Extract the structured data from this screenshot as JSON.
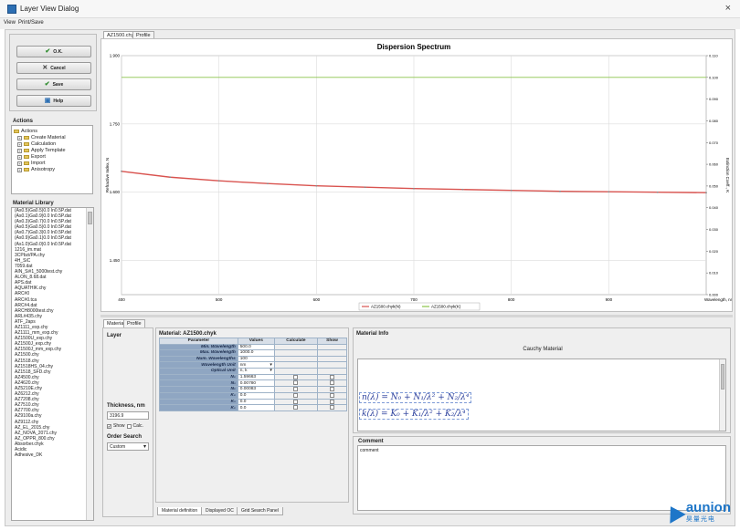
{
  "window": {
    "title": "Layer View Dialog",
    "close_glyph": "×"
  },
  "menu": {
    "items": [
      "View",
      "Print/Save"
    ]
  },
  "buttons": {
    "ok": "O.K.",
    "cancel": "Cancel",
    "save": "Save",
    "help": "Help"
  },
  "actions": {
    "title": "Actions",
    "root": "Actions",
    "items": [
      "Create Material",
      "Calculation",
      "Apply Template",
      "Export",
      "Import",
      "Anisotropy"
    ]
  },
  "material_library": {
    "title": "Material Library",
    "items": [
      "(As0.5)Ga0.5)0.0 In0.5P.dat",
      "(As0.1)Ga0.9)0.0 In0.5P.dat",
      "(As0.3)Ga0.7)0.0 In0.5P.dat",
      "(As0.5)Ga0.5)0.0 In0.5P.dat",
      "(As0.7)Ga0.3)0.0 In0.5P.dat",
      "(As0.9)Ga0.1)0.0 In0.5P.dat",
      "(As1.0)Ga0.0)0.0 In0.5P.dat",
      "1216_im.mat",
      "3CPbzi/PA.chy",
      "4H_SiC",
      "7059.dat",
      "AIN_Si#1_5000test.chy",
      "ALON_8.68.dat",
      "APS.dat",
      "AQUATHIK.chy",
      "ARC#0",
      "ARC#0.tca",
      "ARC#4.dat",
      "ARCH8000test.chy",
      "ARL#435.chy",
      "ATF_2aps",
      "AZ1111_exp.chy",
      "AZ1111_mm_exp.chy",
      "AZ1500U_exp.chy",
      "AZ1500J_exp.chy",
      "AZ1500J_mm_exp.chy",
      "AZ1500.chy",
      "AZ1518.chy",
      "AZ1518HS_04.chy",
      "AZ1518_SFD.chy",
      "AZ4500.chy",
      "AZ4620.chy",
      "AZ5210E.chy",
      "AZ6212.chy",
      "AZ7208.chy",
      "AZ7510.chy",
      "AZ7700.chy",
      "AZ9100a.chy",
      "AZ9112.chy",
      "AZ_EL_2015.chy",
      "AZ_NOVA_2071.chy",
      "AZ_OPPR_800.chy",
      "Absorber.chyk",
      "Acidic",
      "Adhesive_DK"
    ]
  },
  "tabs_top": {
    "file": "AZ1500.chyk",
    "profile": "Profile"
  },
  "chart_data": {
    "type": "line",
    "title": "Dispersion Spectrum",
    "xlabel": "Wavelength, nm",
    "ylabel": "Refractive Index, N",
    "y2label": "Extinction Coeff., K",
    "x_ticks": [
      "400",
      "500",
      "600",
      "700",
      "800",
      "900"
    ],
    "y_ticks": [
      "1.900",
      "1.750",
      "1.600",
      "1.450"
    ],
    "y2_ticks": [
      "0.110",
      "0.100",
      "0.090",
      "0.080",
      "0.070",
      "0.060",
      "0.050",
      "0.040",
      "0.030",
      "0.020",
      "0.010",
      "0.000"
    ],
    "xlim": [
      400,
      1000
    ],
    "ylim": [
      1.375,
      1.9
    ],
    "y2lim": [
      0,
      0.11
    ],
    "grid": true,
    "legend_position": "bottom-center",
    "series": [
      {
        "name": "AZ1500.chyk(N)",
        "color": "#d9534f",
        "x": [
          400,
          450,
          500,
          550,
          600,
          650,
          700,
          750,
          800,
          850,
          900,
          950,
          1000
        ],
        "y": [
          1.646,
          1.633,
          1.625,
          1.619,
          1.614,
          1.611,
          1.608,
          1.606,
          1.604,
          1.602,
          1.601,
          1.6,
          1.599
        ]
      },
      {
        "name": "AZ1500.chyk(K)",
        "color": "#8bc34a",
        "x": [
          400,
          450,
          500,
          550,
          600,
          650,
          700,
          750,
          800,
          850,
          900,
          950,
          1000
        ],
        "y": [
          0.1,
          0.1,
          0.1,
          0.1,
          0.1,
          0.1,
          0.1,
          0.1,
          0.1,
          0.1,
          0.1,
          0.1,
          0.1
        ]
      }
    ]
  },
  "lower_tabs": {
    "material": "Material",
    "profile": "Profile"
  },
  "layer": {
    "title": "Layer",
    "thickness_label": "Thickness, nm",
    "thickness_value": "3196.9",
    "show_calc_label": "Show",
    "calc_label": "Calc.",
    "order_search_label": "Order Search",
    "order_search_value": "Custom"
  },
  "material_panel": {
    "title": "Material: AZ1500.chyk",
    "headers": [
      "Parameter",
      "Values",
      "Calculate",
      "Show"
    ],
    "rows": [
      {
        "name": "Min. Wavelength",
        "value": "500.0",
        "checks": false
      },
      {
        "name": "Max. Wavelength",
        "value": "1000.0",
        "checks": false
      },
      {
        "name": "Num. Wavelengths",
        "value": "100",
        "checks": false
      },
      {
        "name": "Wavelength Unit",
        "value": "nm",
        "checks": false,
        "dropdown": true
      },
      {
        "name": "Optical Unit",
        "value": "n, k",
        "checks": false,
        "dropdown": true
      },
      {
        "name": "N₀",
        "value": "1.59663",
        "checks": true
      },
      {
        "name": "N₁",
        "value": "0.00780",
        "checks": true
      },
      {
        "name": "N₂",
        "value": "0.00083",
        "checks": true
      },
      {
        "name": "K₀",
        "value": "0.0",
        "checks": true
      },
      {
        "name": "K₁",
        "value": "0.0",
        "checks": true
      },
      {
        "name": "K₂",
        "value": "0.0",
        "checks": true
      }
    ]
  },
  "bottom_tabs": [
    "Material definition",
    "Displayed OC",
    "Grid Search Panel"
  ],
  "material_info": {
    "title": "Material Info",
    "model": "Cauchy Material",
    "formula_n": "n(λ) = N₀ + N₁/λ² + N₂/λ⁴",
    "formula_k": "k(λ) = K₀ + K₁/λ² + K₂/λ⁴"
  },
  "comment": {
    "title": "Comment",
    "value": "comment"
  },
  "brand": {
    "name": "aunion",
    "sub": "昊量光电",
    "color": "#1e76c8"
  }
}
